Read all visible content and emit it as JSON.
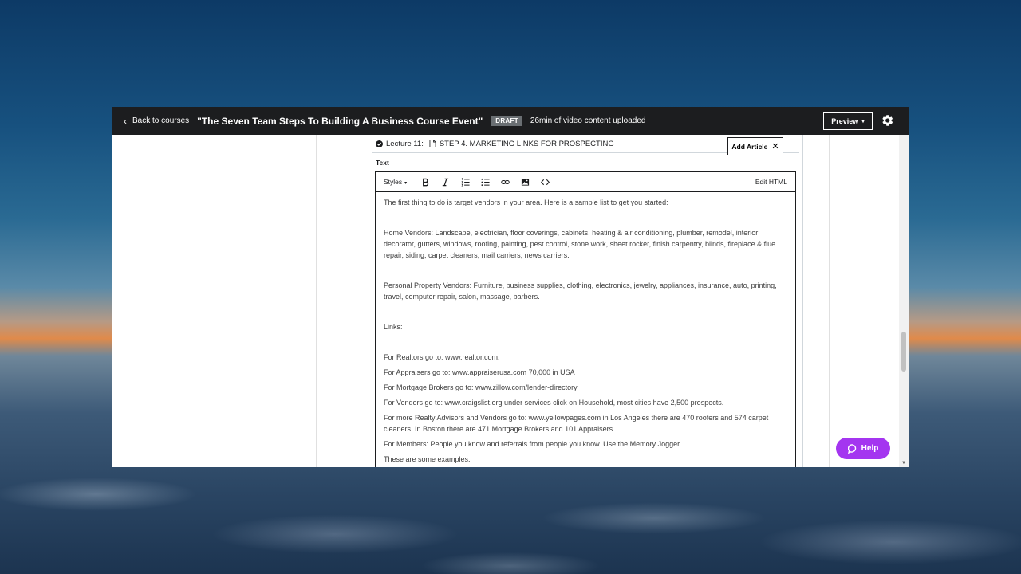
{
  "header": {
    "back_label": "Back to courses",
    "course_title": "\"The Seven Team Steps To Building A Business Course Event\"",
    "status_badge": "DRAFT",
    "upload_status": "26min of video content uploaded",
    "preview_label": "Preview"
  },
  "lecture": {
    "number_label": "Lecture 11:",
    "title": "STEP 4. MARKETING LINKS FOR PROSPECTING",
    "add_article_label": "Add Article"
  },
  "editor": {
    "section_label": "Text",
    "styles_label": "Styles",
    "edit_html_label": "Edit HTML",
    "paragraphs": {
      "intro": "The first thing to do is target vendors in your area. Here is a sample list to get you started:",
      "home_vendors": "Home Vendors: Landscape, electrician, floor coverings, cabinets, heating & air conditioning, plumber, remodel, interior decorator, gutters, windows, roofing, painting, pest control, stone work, sheet rocker, finish carpentry, blinds, fireplace & flue repair, siding, carpet cleaners, mail carriers, news carriers.",
      "personal_vendors": "Personal Property Vendors: Furniture, business supplies, clothing, electronics, jewelry, appliances, insurance, auto, printing, travel, computer repair, salon, massage, barbers.",
      "links_heading": "Links:",
      "realtors": "For Realtors go to: www.realtor.com.",
      "appraisers": "For Appraisers go to: www.appraiserusa.com 70,000 in USA",
      "mortgage": "For Mortgage Brokers go to: www.zillow.com/lender-directory",
      "vendors": "For Vendors go to: www.craigslist.org under services click on Household, most cities have 2,500 prospects.",
      "realty_advisors": "For more Realty Advisors and Vendors go to: www.yellowpages.com in Los Angeles there are 470 roofers and 574 carpet cleaners. In Boston there are 471 Mortgage Brokers and 101 Appraisers.",
      "members": "For Members: People you know and referrals from people you know. Use the Memory Jogger",
      "examples": "These are some examples."
    }
  },
  "help": {
    "label": "Help"
  },
  "colors": {
    "header_bg": "#1c1d1f",
    "help_bg": "#a435f0",
    "draft_badge_bg": "#6a6f73"
  }
}
